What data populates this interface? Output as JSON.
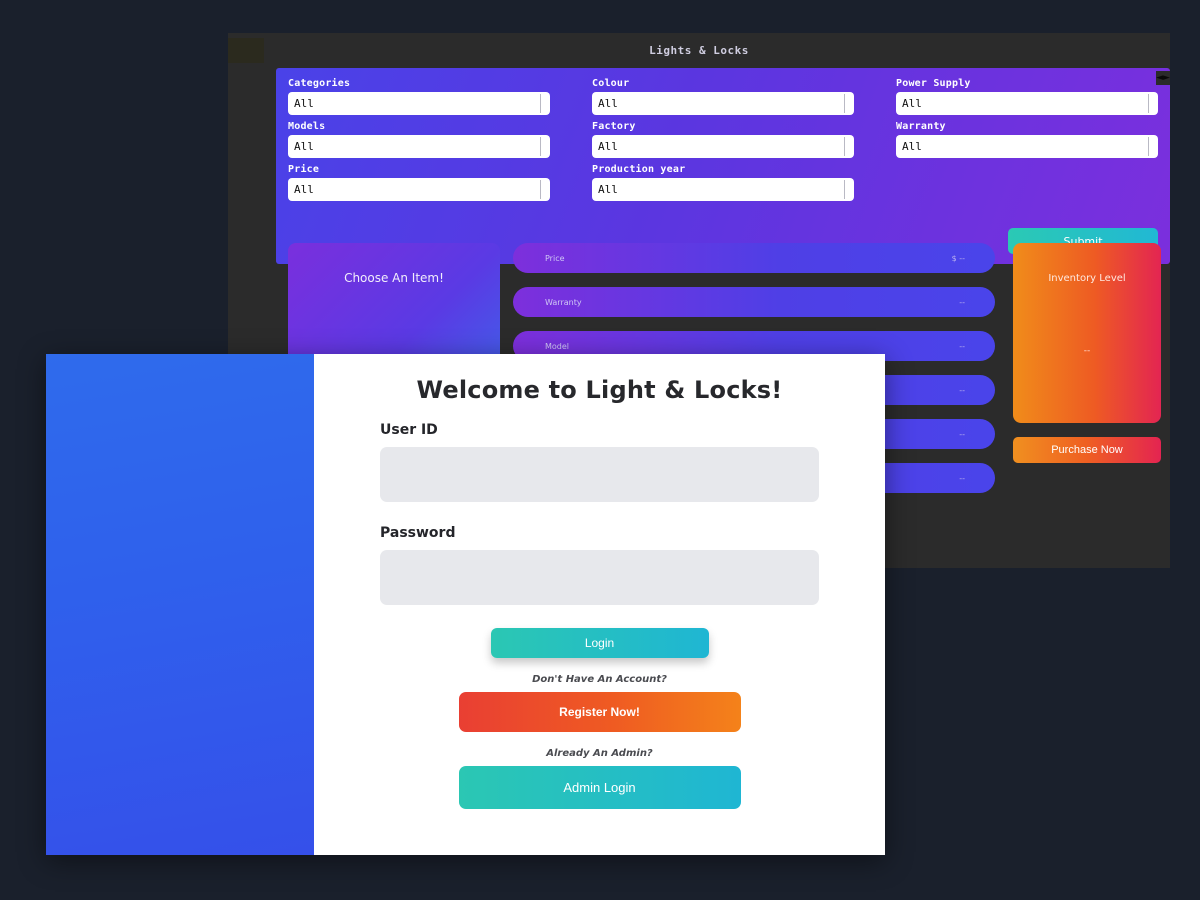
{
  "app": {
    "title": "Lights & Locks",
    "logo_icon": "logo-placeholder-icon",
    "resize_handle_icon": "resize-handle-icon"
  },
  "filters": {
    "fields": [
      {
        "label": "Categories",
        "value": "All"
      },
      {
        "label": "Colour",
        "value": "All"
      },
      {
        "label": "Power Supply",
        "value": "All"
      },
      {
        "label": "Models",
        "value": "All"
      },
      {
        "label": "Factory",
        "value": "All"
      },
      {
        "label": "Warranty",
        "value": "All"
      },
      {
        "label": "Price",
        "value": "All"
      },
      {
        "label": "Production year",
        "value": "All"
      }
    ],
    "submit_label": "Submit"
  },
  "product": {
    "choose_item_label": "Choose An Item!",
    "spec_rows": [
      {
        "label": "Price",
        "value": "$ --"
      },
      {
        "label": "Warranty",
        "value": "--"
      },
      {
        "label": "Model",
        "value": "--"
      },
      {
        "label": "",
        "value": "--"
      },
      {
        "label": "",
        "value": "--"
      },
      {
        "label": "",
        "value": "--"
      }
    ],
    "inventory_title": "Inventory Level",
    "inventory_value": "--",
    "purchase_label": "Purchase Now"
  },
  "login": {
    "heading": "Welcome to Light & Locks!",
    "user_id_label": "User ID",
    "user_id_value": "",
    "user_id_placeholder": "",
    "password_label": "Password",
    "password_value": "",
    "password_placeholder": "",
    "login_label": "Login",
    "register_prompt": "Don't Have An Account?",
    "register_label": "Register Now!",
    "admin_prompt": "Already An Admin?",
    "admin_label": "Admin Login"
  },
  "colors": {
    "page_background": "#1a202c",
    "app_window": "#2b2b2b",
    "filter_purple": "#5b36e0",
    "accent_teal": "#2bc7b3",
    "accent_cyan": "#1fb6d3",
    "accent_orange": "#ef5b22",
    "accent_red": "#e32552",
    "modal_art_blue": "#2f60ec"
  }
}
